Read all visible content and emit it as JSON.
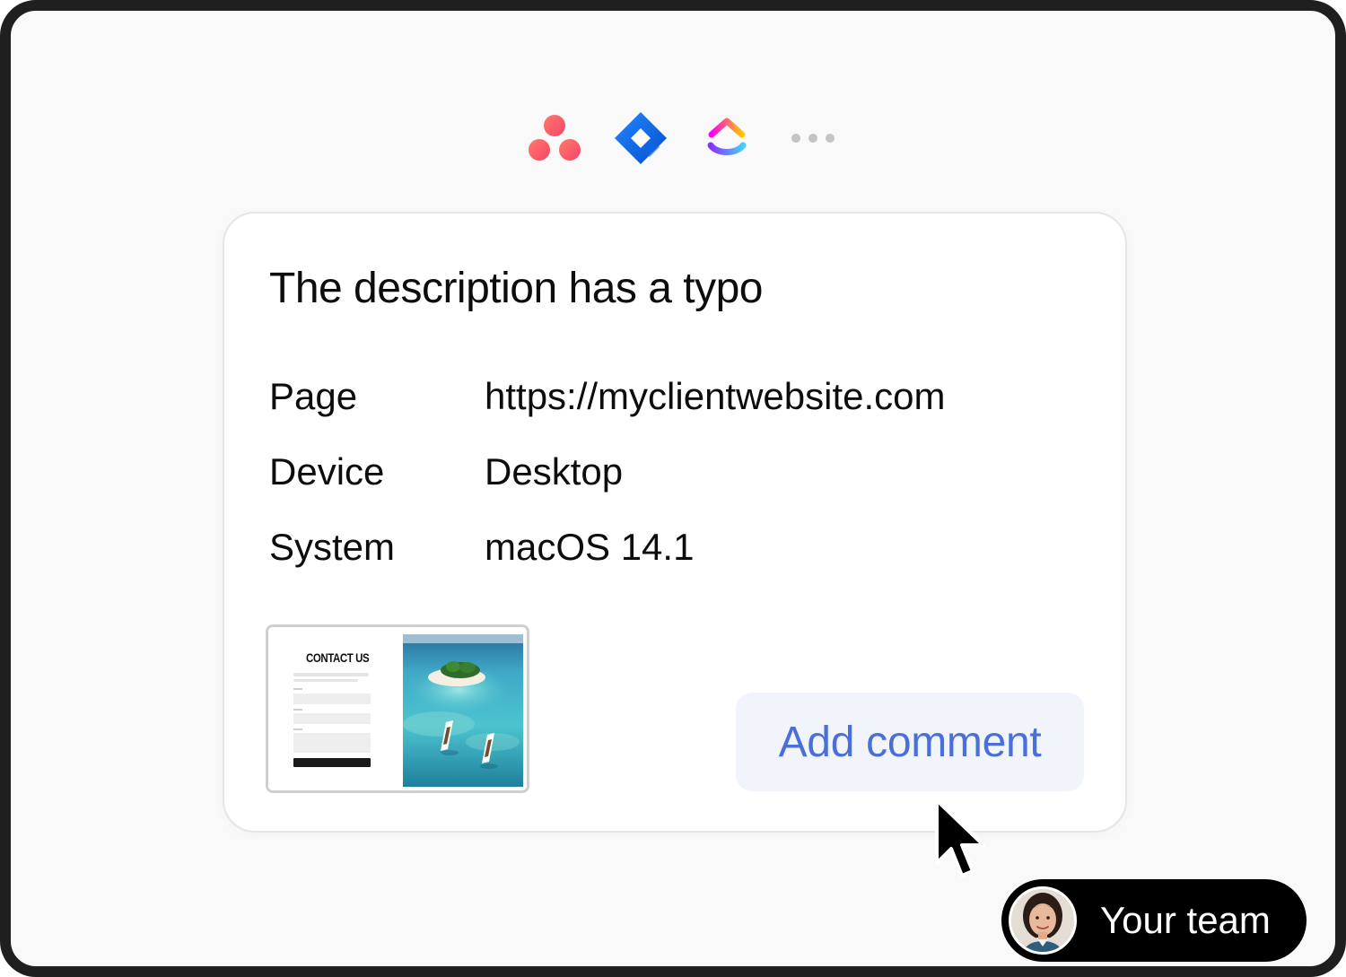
{
  "integrations": [
    {
      "name": "asana-icon"
    },
    {
      "name": "jira-icon"
    },
    {
      "name": "clickup-icon"
    },
    {
      "name": "more-icon"
    }
  ],
  "card": {
    "title": "The description has a typo",
    "meta": [
      {
        "label": "Page",
        "value": "https://myclientwebsite.com"
      },
      {
        "label": "Device",
        "value": "Desktop"
      },
      {
        "label": "System",
        "value": "macOS 14.1"
      }
    ],
    "screenshot": {
      "form_title": "CONTACT US"
    },
    "add_comment_label": "Add comment"
  },
  "team": {
    "label": "Your team"
  },
  "colors": {
    "accent": "#4a6fd8",
    "button_bg": "#f2f4fb",
    "frame_border": "#1f1f1f",
    "asana": "#f06a6a",
    "jira": "#2684ff"
  }
}
